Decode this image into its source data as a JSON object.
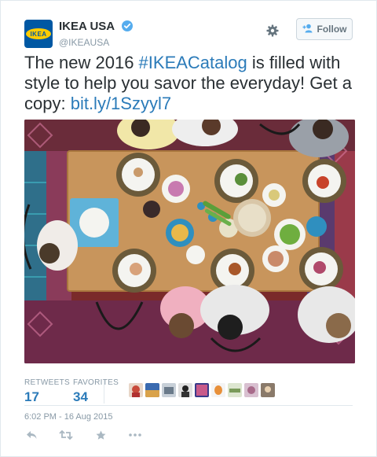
{
  "account": {
    "display_name": "IKEA USA",
    "handle": "@IKEAUSA",
    "logo_text": "IKEA",
    "brand_blue": "#0058a3",
    "brand_yellow": "#ffcc00"
  },
  "follow_button": {
    "label": "Follow",
    "icon": "follow-person-icon"
  },
  "settings_icon": "gear-icon",
  "tweet": {
    "text_1": "The new 2016 ",
    "hashtag": "#IKEACatalog",
    "text_2": " is filled with style to help you savor the everyday! Get a copy: ",
    "link": "bit.ly/1Szyyl7",
    "link_color": "#2b7bb9"
  },
  "stats": {
    "retweets_label": "RETWEETS",
    "retweets_count": "17",
    "favorites_label": "FAVORITES",
    "favorites_count": "34"
  },
  "timestamp": "6:02 PM - 16 Aug 2015",
  "actions": [
    "reply-icon",
    "retweet-icon",
    "favorite-icon",
    "more-icon"
  ]
}
